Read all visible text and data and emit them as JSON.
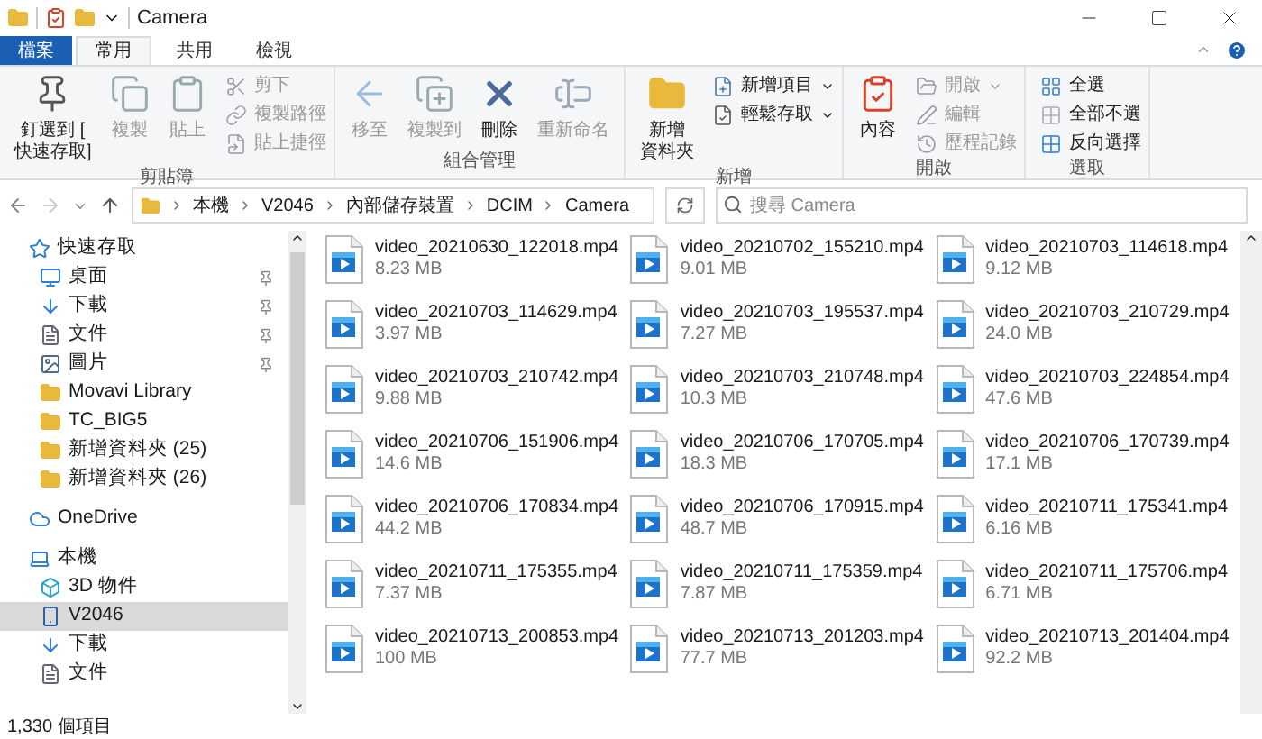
{
  "window": {
    "title": "Camera"
  },
  "ribbon_tabs": [
    {
      "label": "檔案",
      "kind": "file",
      "selected": false
    },
    {
      "label": "常用",
      "kind": "tab",
      "selected": true
    },
    {
      "label": "共用",
      "kind": "tab",
      "selected": false
    },
    {
      "label": "檢視",
      "kind": "tab",
      "selected": false
    }
  ],
  "ribbon_groups": [
    {
      "label": "剪貼簿",
      "large": [
        {
          "lines": [
            "釘選到 [",
            "快速存取]"
          ],
          "kind": "pin",
          "disabled": false
        },
        {
          "lines": [
            "複製"
          ],
          "kind": "copy",
          "disabled": true
        },
        {
          "lines": [
            "貼上"
          ],
          "kind": "paste",
          "disabled": true
        }
      ],
      "small": [
        {
          "label": "剪下",
          "kind": "cut",
          "disabled": true,
          "dropdown": false
        },
        {
          "label": "複製路徑",
          "kind": "path",
          "disabled": true,
          "dropdown": false
        },
        {
          "label": "貼上捷徑",
          "kind": "shortcut",
          "disabled": true,
          "dropdown": false
        }
      ]
    },
    {
      "label": "組合管理",
      "large": [
        {
          "lines": [
            "移至"
          ],
          "kind": "move",
          "disabled": true
        },
        {
          "lines": [
            "複製到"
          ],
          "kind": "copyto",
          "disabled": true
        },
        {
          "lines": [
            "刪除"
          ],
          "kind": "delete",
          "disabled": false
        },
        {
          "lines": [
            "重新命名"
          ],
          "kind": "rename",
          "disabled": true
        }
      ]
    },
    {
      "label": "新增",
      "large": [
        {
          "lines": [
            "新增",
            "資料夾"
          ],
          "kind": "folder",
          "disabled": false
        }
      ],
      "small": [
        {
          "label": "新增項目",
          "kind": "newitem",
          "disabled": false,
          "dropdown": true
        },
        {
          "label": "輕鬆存取",
          "kind": "easy",
          "disabled": false,
          "dropdown": true
        }
      ]
    },
    {
      "label": "開啟",
      "large": [
        {
          "lines": [
            "內容"
          ],
          "kind": "properties",
          "disabled": false
        }
      ],
      "small": [
        {
          "label": "開啟",
          "kind": "open",
          "disabled": true,
          "dropdown": true
        },
        {
          "label": "編輯",
          "kind": "edit",
          "disabled": true,
          "dropdown": false
        },
        {
          "label": "歷程記錄",
          "kind": "history",
          "disabled": true,
          "dropdown": false
        }
      ]
    },
    {
      "label": "選取",
      "small": [
        {
          "label": "全選",
          "kind": "selectall",
          "disabled": false,
          "dropdown": false
        },
        {
          "label": "全部不選",
          "kind": "selectnone",
          "disabled": false,
          "dropdown": false
        },
        {
          "label": "反向選擇",
          "kind": "invert",
          "disabled": false,
          "dropdown": false
        }
      ]
    }
  ],
  "breadcrumbs": [
    "本機",
    "V2046",
    "內部儲存裝置",
    "DCIM",
    "Camera"
  ],
  "search": {
    "placeholder": "搜尋 Camera"
  },
  "sidebar": {
    "items": [
      {
        "label": "快速存取",
        "kind": "star",
        "selected": false,
        "pinned": false,
        "children": [
          {
            "label": "桌面",
            "kind": "desktop",
            "selected": false,
            "pinned": true
          },
          {
            "label": "下載",
            "kind": "download",
            "selected": false,
            "pinned": true
          },
          {
            "label": "文件",
            "kind": "document",
            "selected": false,
            "pinned": true
          },
          {
            "label": "圖片",
            "kind": "picture",
            "selected": false,
            "pinned": true
          },
          {
            "label": "Movavi Library",
            "kind": "folder",
            "selected": false,
            "pinned": false
          },
          {
            "label": "TC_BIG5",
            "kind": "folder",
            "selected": false,
            "pinned": false
          },
          {
            "label": "新增資料夾 (25)",
            "kind": "folder",
            "selected": false,
            "pinned": false
          },
          {
            "label": "新增資料夾 (26)",
            "kind": "folder",
            "selected": false,
            "pinned": false
          }
        ]
      },
      {
        "label": "OneDrive",
        "kind": "cloud",
        "selected": false,
        "pinned": false
      },
      {
        "label": "本機",
        "kind": "pc",
        "selected": false,
        "pinned": false,
        "children": [
          {
            "label": "3D 物件",
            "kind": "cube",
            "selected": false,
            "pinned": false
          },
          {
            "label": "V2046",
            "kind": "phone",
            "selected": true,
            "pinned": false
          },
          {
            "label": "下載",
            "kind": "download",
            "selected": false,
            "pinned": false
          },
          {
            "label": "文件",
            "kind": "document",
            "selected": false,
            "pinned": false
          }
        ]
      }
    ]
  },
  "files": [
    {
      "name": "video_20210630_122018.mp4",
      "size": "8.23 MB"
    },
    {
      "name": "video_20210702_155210.mp4",
      "size": "9.01 MB"
    },
    {
      "name": "video_20210703_114618.mp4",
      "size": "9.12 MB"
    },
    {
      "name": "video_20210703_114629.mp4",
      "size": "3.97 MB"
    },
    {
      "name": "video_20210703_195537.mp4",
      "size": "7.27 MB"
    },
    {
      "name": "video_20210703_210729.mp4",
      "size": "24.0 MB"
    },
    {
      "name": "video_20210703_210742.mp4",
      "size": "9.88 MB"
    },
    {
      "name": "video_20210703_210748.mp4",
      "size": "10.3 MB"
    },
    {
      "name": "video_20210703_224854.mp4",
      "size": "47.6 MB"
    },
    {
      "name": "video_20210706_151906.mp4",
      "size": "14.6 MB"
    },
    {
      "name": "video_20210706_170705.mp4",
      "size": "18.3 MB"
    },
    {
      "name": "video_20210706_170739.mp4",
      "size": "17.1 MB"
    },
    {
      "name": "video_20210706_170834.mp4",
      "size": "44.2 MB"
    },
    {
      "name": "video_20210706_170915.mp4",
      "size": "48.7 MB"
    },
    {
      "name": "video_20210711_175341.mp4",
      "size": "6.16 MB"
    },
    {
      "name": "video_20210711_175355.mp4",
      "size": "7.37 MB"
    },
    {
      "name": "video_20210711_175359.mp4",
      "size": "7.87 MB"
    },
    {
      "name": "video_20210711_175706.mp4",
      "size": "6.71 MB"
    },
    {
      "name": "video_20210713_200853.mp4",
      "size": "100 MB"
    },
    {
      "name": "video_20210713_201203.mp4",
      "size": "77.7 MB"
    },
    {
      "name": "video_20210713_201404.mp4",
      "size": "92.2 MB"
    }
  ],
  "status_bar": {
    "item_count": "1,330 個項目"
  }
}
